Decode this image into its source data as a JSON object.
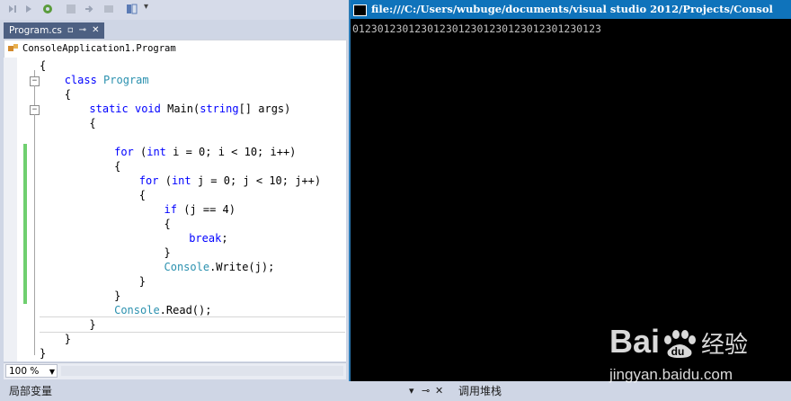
{
  "ide": {
    "tab": {
      "label": "Program.cs",
      "pin_glyph": "▫",
      "dock_glyph": "⊸",
      "close_glyph": "✕"
    },
    "nav": {
      "class_path": "ConsoleApplication1.Program"
    },
    "code_lines": [
      {
        "indent": 0,
        "tokens": [
          {
            "t": "{",
            "c": "p"
          }
        ]
      },
      {
        "indent": 1,
        "tokens": [
          {
            "t": "class ",
            "c": "kw"
          },
          {
            "t": "Program",
            "c": "ty"
          }
        ]
      },
      {
        "indent": 1,
        "tokens": [
          {
            "t": "{",
            "c": "p"
          }
        ]
      },
      {
        "indent": 2,
        "tokens": [
          {
            "t": "static void ",
            "c": "kw"
          },
          {
            "t": "Main(",
            "c": "p"
          },
          {
            "t": "string",
            "c": "kw"
          },
          {
            "t": "[] args)",
            "c": "p"
          }
        ]
      },
      {
        "indent": 2,
        "tokens": [
          {
            "t": "{",
            "c": "p"
          }
        ]
      },
      {
        "indent": 0,
        "tokens": []
      },
      {
        "indent": 3,
        "tokens": [
          {
            "t": "for ",
            "c": "kw"
          },
          {
            "t": "(",
            "c": "p"
          },
          {
            "t": "int ",
            "c": "kw"
          },
          {
            "t": "i = 0; i < 10; i++)",
            "c": "p"
          }
        ]
      },
      {
        "indent": 3,
        "tokens": [
          {
            "t": "{",
            "c": "p"
          }
        ]
      },
      {
        "indent": 4,
        "tokens": [
          {
            "t": "for ",
            "c": "kw"
          },
          {
            "t": "(",
            "c": "p"
          },
          {
            "t": "int ",
            "c": "kw"
          },
          {
            "t": "j = 0; j < 10; j++)",
            "c": "p"
          }
        ]
      },
      {
        "indent": 4,
        "tokens": [
          {
            "t": "{",
            "c": "p"
          }
        ]
      },
      {
        "indent": 5,
        "tokens": [
          {
            "t": "if ",
            "c": "kw"
          },
          {
            "t": "(j == 4)",
            "c": "p"
          }
        ]
      },
      {
        "indent": 5,
        "tokens": [
          {
            "t": "{",
            "c": "p"
          }
        ]
      },
      {
        "indent": 6,
        "tokens": [
          {
            "t": "break",
            "c": "kw"
          },
          {
            "t": ";",
            "c": "p"
          }
        ]
      },
      {
        "indent": 5,
        "tokens": [
          {
            "t": "}",
            "c": "p"
          }
        ]
      },
      {
        "indent": 5,
        "tokens": [
          {
            "t": "Console",
            "c": "ty"
          },
          {
            "t": ".Write(j);",
            "c": "p"
          }
        ]
      },
      {
        "indent": 4,
        "tokens": [
          {
            "t": "}",
            "c": "p"
          }
        ]
      },
      {
        "indent": 3,
        "tokens": [
          {
            "t": "}",
            "c": "p"
          }
        ]
      },
      {
        "indent": 3,
        "tokens": [
          {
            "t": "Console",
            "c": "ty"
          },
          {
            "t": ".Read();",
            "c": "p"
          }
        ]
      },
      {
        "indent": 2,
        "tokens": [
          {
            "t": "}",
            "c": "p"
          }
        ]
      },
      {
        "indent": 1,
        "tokens": [
          {
            "t": "}",
            "c": "p"
          }
        ]
      },
      {
        "indent": 0,
        "tokens": [
          {
            "t": "}",
            "c": "p"
          }
        ]
      }
    ],
    "zoom": "100 %",
    "bottom": {
      "left_panel": "局部变量",
      "right_panel": "调用堆栈",
      "pin_glyph": "▾",
      "dock_glyph": "⊸",
      "close_glyph": "✕"
    }
  },
  "console": {
    "title": "file:///C:/Users/wubuge/documents/visual studio 2012/Projects/Consol",
    "output": "0123012301230123012301230123012301230123"
  },
  "watermark": {
    "brand": "Bai",
    "brand2": "du",
    "cn": "经验",
    "url": "jingyan.baidu.com"
  },
  "colors": {
    "keyword": "#0000ff",
    "type": "#2b91af",
    "tab_active": "#4d6082",
    "console_title": "#0f73bb",
    "change_bar": "#6fcf6f"
  }
}
